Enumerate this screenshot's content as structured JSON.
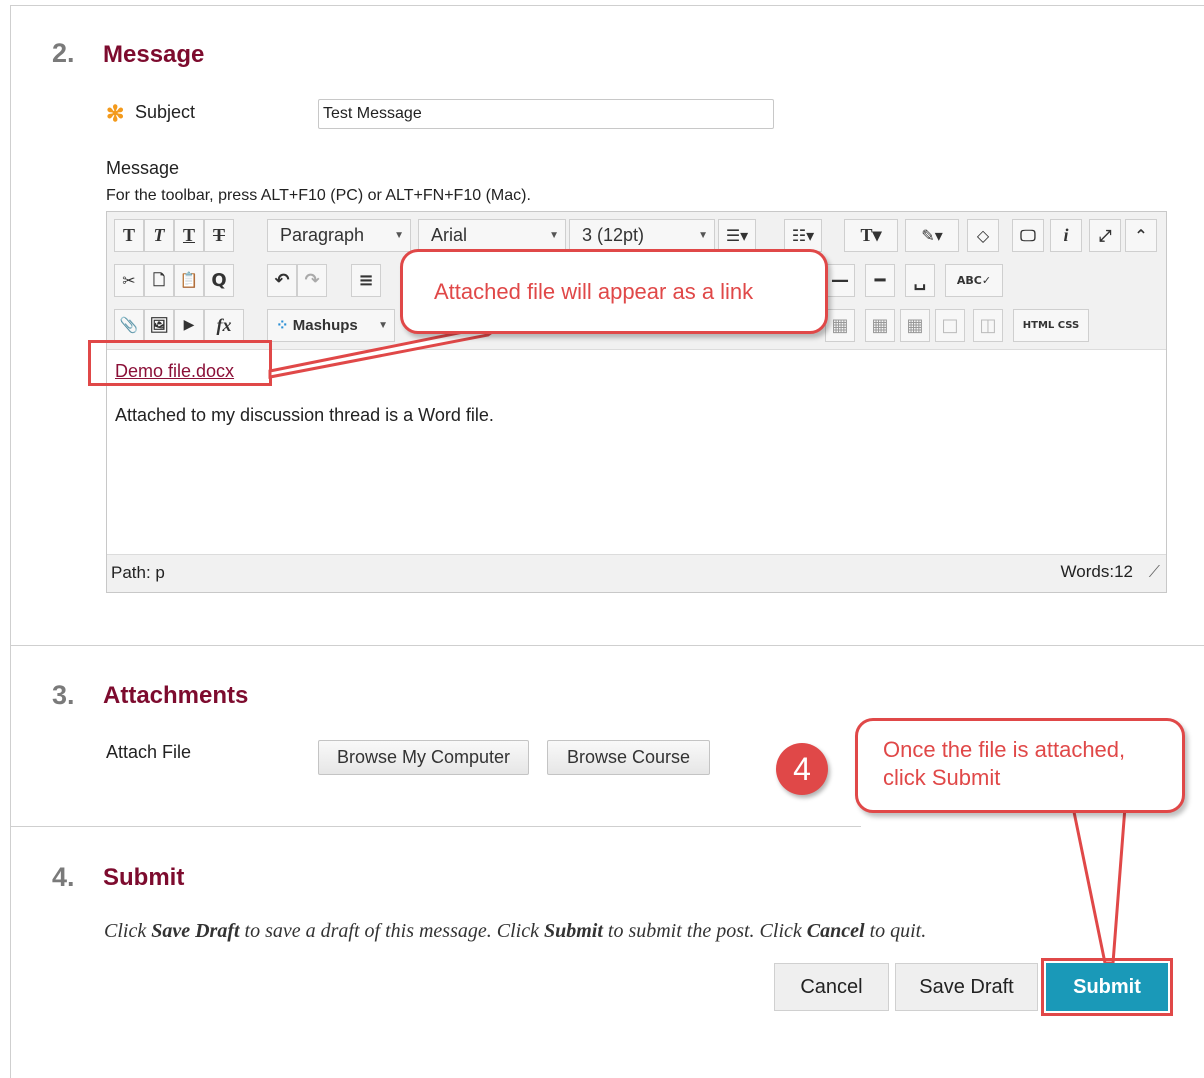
{
  "sections": {
    "message": {
      "number": "2.",
      "title": "Message"
    },
    "attachments": {
      "number": "3.",
      "title": "Attachments"
    },
    "submit": {
      "number": "4.",
      "title": "Submit"
    }
  },
  "subject": {
    "required_marker": "✻",
    "label": "Subject",
    "value": "Test Message"
  },
  "message_field": {
    "label": "Message",
    "toolbar_hint": "For the toolbar, press ALT+F10 (PC) or ALT+FN+F10 (Mac)."
  },
  "toolbar": {
    "format_select": "Paragraph",
    "font_select": "Arial",
    "size_select": "3 (12pt)",
    "mashups": "Mashups",
    "html_label": "HTML",
    "css_label": "CSS",
    "glyphs": {
      "bold": "T",
      "italic": "T",
      "underline": "T",
      "strike": "T",
      "cut": "✂",
      "copy": "🗋",
      "paste": "📋",
      "find": "Q",
      "undo": "↶",
      "redo": "↷",
      "align": "≡",
      "attach": "📎",
      "image": "🖼",
      "media": "▶",
      "math": "fx",
      "text_color": "T",
      "highlight": "✎",
      "eraser": "◇",
      "preview": "🖵",
      "info": "i",
      "expand": "⤢",
      "collapse": "⌃",
      "spell": "ABC✓"
    }
  },
  "editor": {
    "link_text": "Demo file.docx",
    "body_text": "Attached to my discussion thread is a Word file.",
    "path": "Path: p",
    "word_count": "Words:12"
  },
  "callouts": {
    "link_note": "Attached file will appear as a link",
    "submit_note_line1": "Once the file is attached,",
    "submit_note_line2": "click Submit",
    "step_badge": "4"
  },
  "attachments": {
    "label": "Attach File",
    "browse_computer": "Browse My Computer",
    "browse_course": "Browse Course"
  },
  "submit": {
    "inst_1": "Click ",
    "inst_2": "Save Draft",
    "inst_3": " to save a draft of this message. Click ",
    "inst_4": "Submit",
    "inst_5": " to submit the post. Click ",
    "inst_6": "Cancel",
    "inst_7": " to quit.",
    "cancel": "Cancel",
    "save_draft": "Save Draft",
    "submit": "Submit"
  }
}
